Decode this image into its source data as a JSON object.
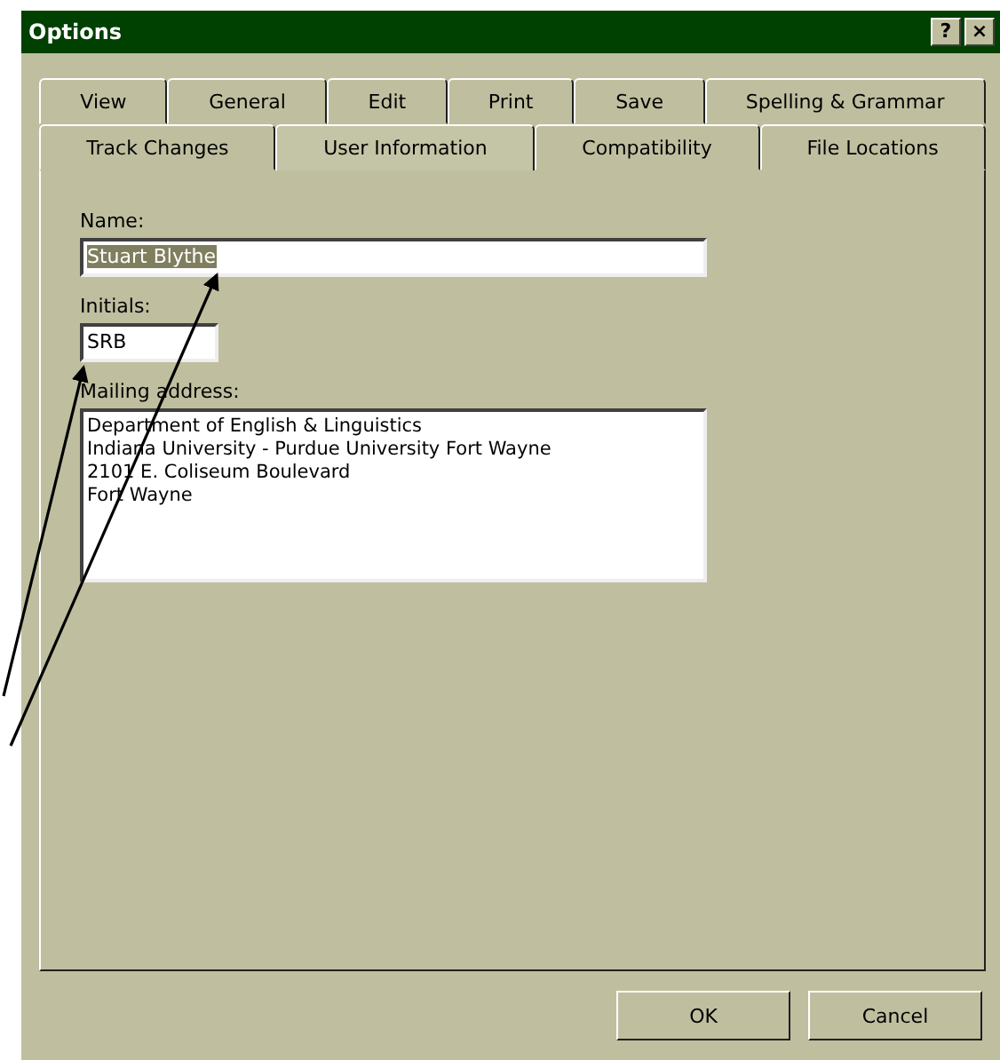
{
  "window": {
    "title": "Options",
    "help_button": "?",
    "close_button": "×"
  },
  "tab_rows": [
    {
      "tabs": [
        {
          "label": "View",
          "selected": false
        },
        {
          "label": "General",
          "selected": false
        },
        {
          "label": "Edit",
          "selected": false
        },
        {
          "label": "Print",
          "selected": false
        },
        {
          "label": "Save",
          "selected": false
        },
        {
          "label": "Spelling & Grammar",
          "selected": false
        }
      ]
    },
    {
      "tabs": [
        {
          "label": "Track Changes",
          "selected": false
        },
        {
          "label": "User Information",
          "selected": true
        },
        {
          "label": "Compatibility",
          "selected": false
        },
        {
          "label": "File Locations",
          "selected": false
        }
      ]
    }
  ],
  "fields": [
    {
      "kind": "line",
      "label": "Name:",
      "value": "Stuart Blythe",
      "text_selected": true
    },
    {
      "kind": "short",
      "label": "Initials:",
      "value": "SRB",
      "text_selected": false
    },
    {
      "kind": "area",
      "label": "Mailing address:",
      "lines": [
        "Department of English & Linguistics",
        "Indiana University - Purdue University Fort Wayne",
        "2101 E. Coliseum Boulevard",
        "Fort Wayne"
      ]
    }
  ],
  "buttons": [
    {
      "label": "OK"
    },
    {
      "label": "Cancel"
    }
  ]
}
